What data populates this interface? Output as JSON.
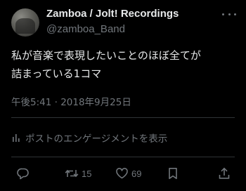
{
  "author": {
    "display_name": "Zamboa / Jolt! Recordings",
    "handle": "@zamboa_Band"
  },
  "tweet": {
    "text_lines": [
      "私が音楽で表現したいことのほぼ全てが",
      "詰まっている1コマ"
    ],
    "timestamp": "午後5:41 · 2018年9月25日"
  },
  "engagement": {
    "label": "ポストのエンゲージメントを表示"
  },
  "actions": {
    "retweets": "15",
    "likes": "69"
  },
  "colors": {
    "background": "#000000",
    "text": "#e7e9ea",
    "muted": "#71767b",
    "divider": "#2f3336"
  },
  "icons": [
    "more-icon",
    "analytics-icon",
    "reply-icon",
    "retweet-icon",
    "like-icon",
    "bookmark-icon",
    "share-icon"
  ]
}
